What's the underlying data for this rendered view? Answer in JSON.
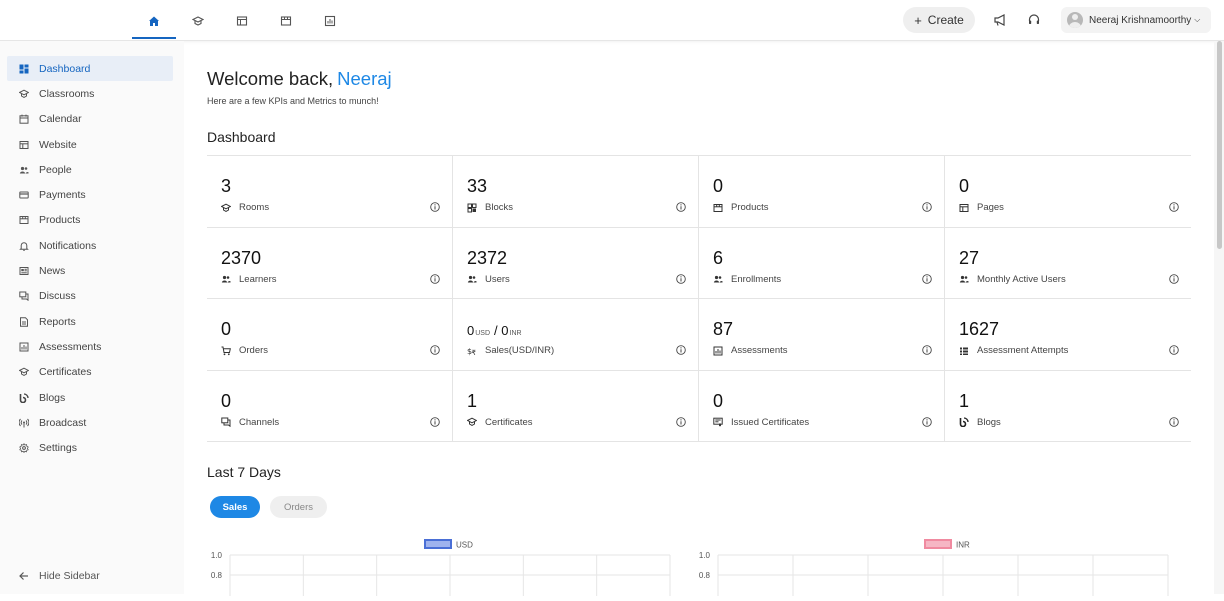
{
  "topbar": {
    "nav": [
      {
        "icon": "home-icon",
        "active": true
      },
      {
        "icon": "classrooms-icon"
      },
      {
        "icon": "website-icon"
      },
      {
        "icon": "products-icon"
      },
      {
        "icon": "reports-icon"
      }
    ],
    "create_label": "Create",
    "user_name": "Neeraj Krishnamoorthy"
  },
  "sidebar": {
    "items": [
      {
        "label": "Dashboard",
        "icon": "dashboard-icon",
        "active": true
      },
      {
        "label": "Classrooms",
        "icon": "classrooms-icon"
      },
      {
        "label": "Calendar",
        "icon": "calendar-icon"
      },
      {
        "label": "Website",
        "icon": "website-icon"
      },
      {
        "label": "People",
        "icon": "people-icon"
      },
      {
        "label": "Payments",
        "icon": "payments-icon"
      },
      {
        "label": "Products",
        "icon": "products-icon"
      },
      {
        "label": "Notifications",
        "icon": "bell-icon"
      },
      {
        "label": "News",
        "icon": "news-icon"
      },
      {
        "label": "Discuss",
        "icon": "discuss-icon"
      },
      {
        "label": "Reports",
        "icon": "reports-icon"
      },
      {
        "label": "Assessments",
        "icon": "assessments-icon"
      },
      {
        "label": "Certificates",
        "icon": "certificates-icon"
      },
      {
        "label": "Blogs",
        "icon": "blogs-icon"
      },
      {
        "label": "Broadcast",
        "icon": "broadcast-icon"
      },
      {
        "label": "Settings",
        "icon": "settings-icon"
      }
    ],
    "hide_label": "Hide Sidebar"
  },
  "main": {
    "welcome_prefix": "Welcome back,",
    "welcome_name": "Neeraj",
    "subtitle": "Here are a few KPIs and Metrics to munch!",
    "dashboard_heading": "Dashboard",
    "last7_heading": "Last 7 Days",
    "tabs": {
      "sales": "Sales",
      "orders": "Orders"
    }
  },
  "metrics": [
    {
      "value": "3",
      "label": "Rooms",
      "icon": "rooms-icon"
    },
    {
      "value": "33",
      "label": "Blocks",
      "icon": "blocks-icon"
    },
    {
      "value": "0",
      "label": "Products",
      "icon": "products-icon"
    },
    {
      "value": "0",
      "label": "Pages",
      "icon": "pages-icon"
    },
    {
      "value": "2370",
      "label": "Learners",
      "icon": "learners-icon"
    },
    {
      "value": "2372",
      "label": "Users",
      "icon": "users-icon"
    },
    {
      "value": "6",
      "label": "Enrollments",
      "icon": "enrollments-icon"
    },
    {
      "value": "27",
      "label": "Monthly Active Users",
      "icon": "active-users-icon"
    },
    {
      "value": "0",
      "label": "Orders",
      "icon": "cart-icon"
    },
    {
      "value": "",
      "label": "Sales(USD/INR)",
      "icon": "currency-icon",
      "sales": {
        "usd_value": "0",
        "usd_unit": "USD",
        "sep": "/",
        "inr_value": "0",
        "inr_unit": "INR"
      }
    },
    {
      "value": "87",
      "label": "Assessments",
      "icon": "assessments-icon"
    },
    {
      "value": "1627",
      "label": "Assessment Attempts",
      "icon": "attempts-icon"
    },
    {
      "value": "0",
      "label": "Channels",
      "icon": "channels-icon"
    },
    {
      "value": "1",
      "label": "Certificates",
      "icon": "certificates-icon"
    },
    {
      "value": "0",
      "label": "Issued Certificates",
      "icon": "issued-certificates-icon"
    },
    {
      "value": "1",
      "label": "Blogs",
      "icon": "blogs-icon"
    }
  ],
  "chart_data": [
    {
      "type": "line",
      "series": [
        {
          "name": "USD",
          "color": "#4a6fd6"
        }
      ],
      "y_ticks": [
        "1.0",
        "0.8"
      ],
      "ylim": [
        0,
        1.0
      ],
      "grid": true,
      "legend": "top-center"
    },
    {
      "type": "line",
      "series": [
        {
          "name": "INR",
          "color": "#f08aa0"
        }
      ],
      "y_ticks": [
        "1.0",
        "0.8"
      ],
      "ylim": [
        0,
        1.0
      ],
      "grid": true,
      "legend": "top-center"
    }
  ],
  "colors": {
    "accent": "#1e88e5",
    "active_nav": "#1565c0"
  }
}
